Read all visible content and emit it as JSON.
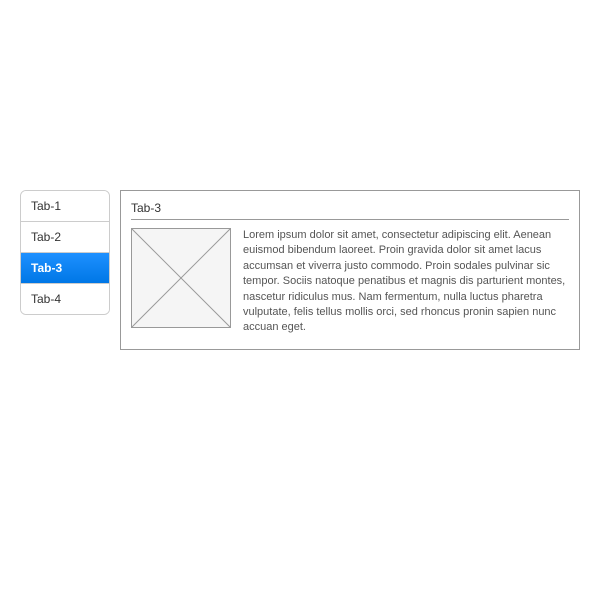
{
  "tabs": [
    {
      "label": "Tab-1",
      "active": false
    },
    {
      "label": "Tab-2",
      "active": false
    },
    {
      "label": "Tab-3",
      "active": true
    },
    {
      "label": "Tab-4",
      "active": false
    }
  ],
  "panel": {
    "title": "Tab-3",
    "text": "Lorem ipsum dolor sit amet, consectetur adipiscing elit. Aenean euismod bibendum laoreet. Proin gravida dolor sit amet lacus accumsan et viverra justo commodo. Proin sodales pulvinar sic tempor. Sociis natoque penatibus et magnis dis parturient montes, nascetur ridiculus mus. Nam fermentum, nulla luctus pharetra vulputate, felis tellus mollis orci, sed rhoncus pronin sapien nunc accuan eget."
  }
}
